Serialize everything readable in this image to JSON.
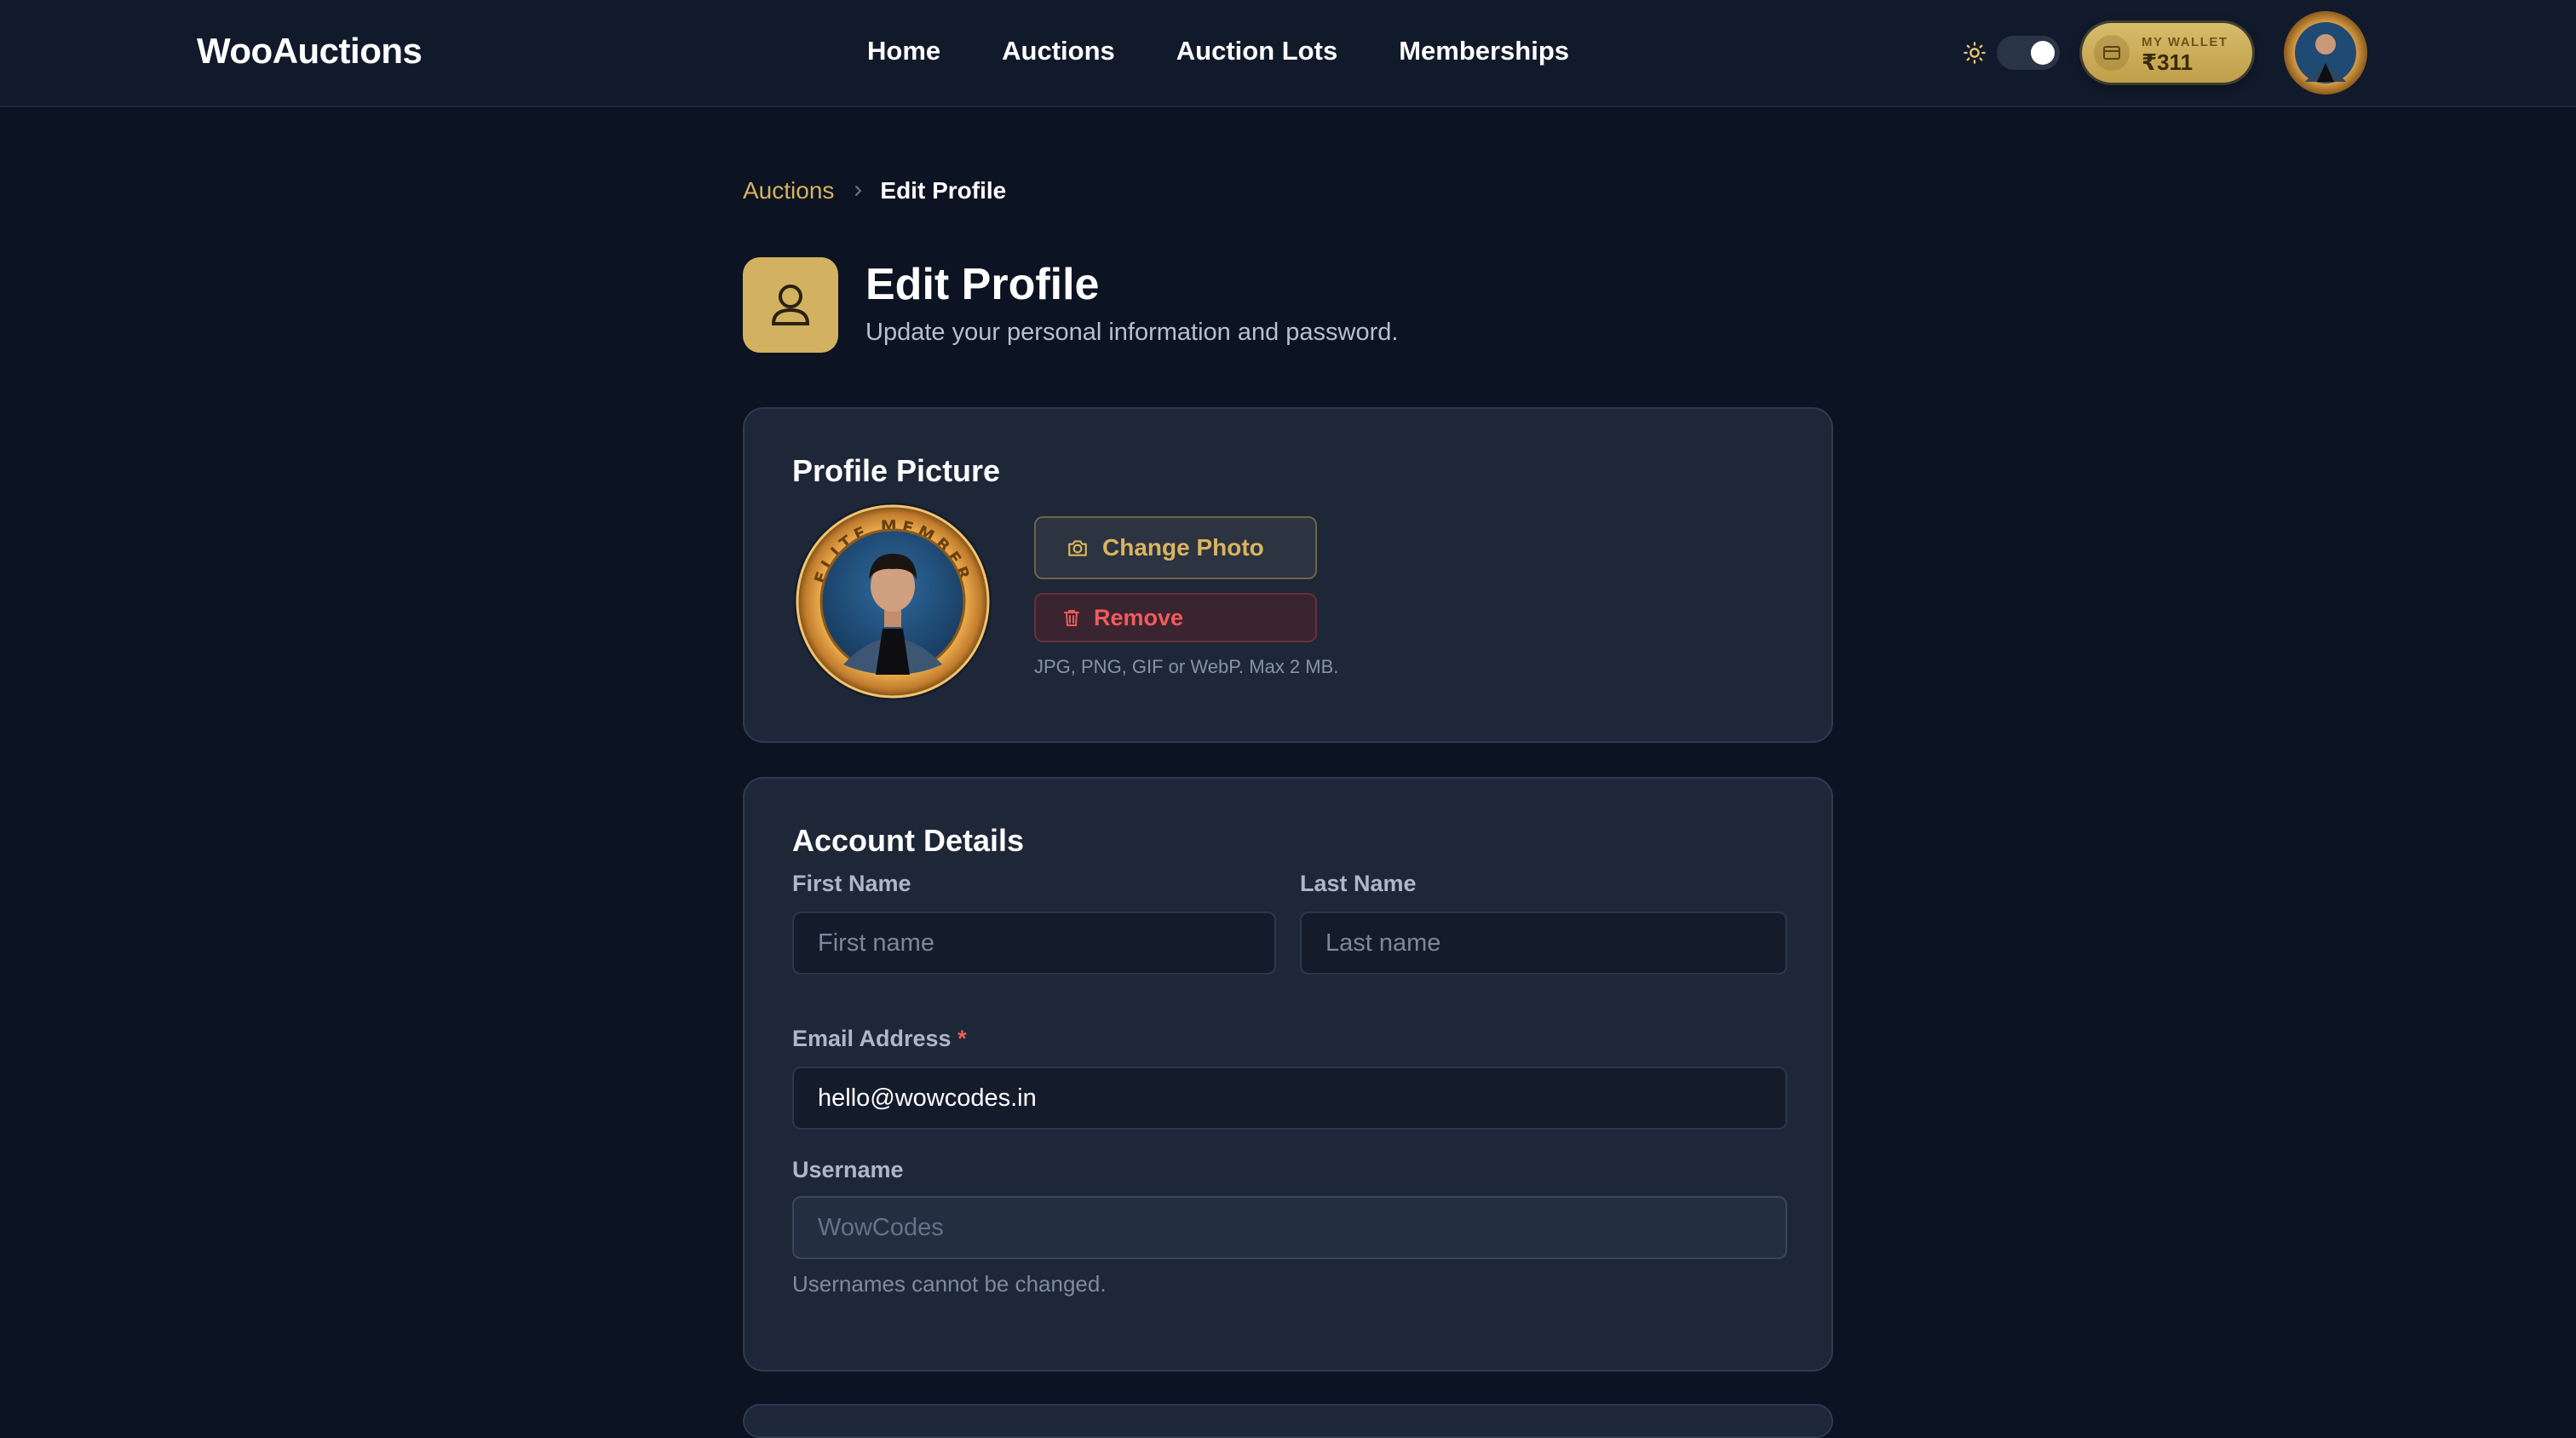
{
  "header": {
    "brand": "WooAuctions",
    "nav": [
      "Home",
      "Auctions",
      "Auction Lots",
      "Memberships"
    ],
    "wallet_label": "MY WALLET",
    "wallet_value": "₹311",
    "theme_toggle": "on"
  },
  "breadcrumb": {
    "parent": "Auctions",
    "current": "Edit Profile"
  },
  "page": {
    "title": "Edit Profile",
    "subtitle": "Update your personal information and password."
  },
  "profile_picture": {
    "title": "Profile Picture",
    "badge_text": "ELITE MEMBER",
    "change_label": "Change Photo",
    "remove_label": "Remove",
    "hint": "JPG, PNG, GIF or WebP. Max 2 MB."
  },
  "account": {
    "title": "Account Details",
    "first_name_label": "First Name",
    "first_name_placeholder": "First name",
    "last_name_label": "Last Name",
    "last_name_placeholder": "Last name",
    "email_label": "Email Address",
    "email_required_mark": "*",
    "email_value": "hello@wowcodes.in",
    "username_label": "Username",
    "username_placeholder": "WowCodes",
    "username_hint": "Usernames cannot be changed."
  },
  "colors": {
    "accent_gold": "#d2b260",
    "danger": "#f05b5b",
    "background": "#0c1322",
    "card": "#1d2738"
  }
}
